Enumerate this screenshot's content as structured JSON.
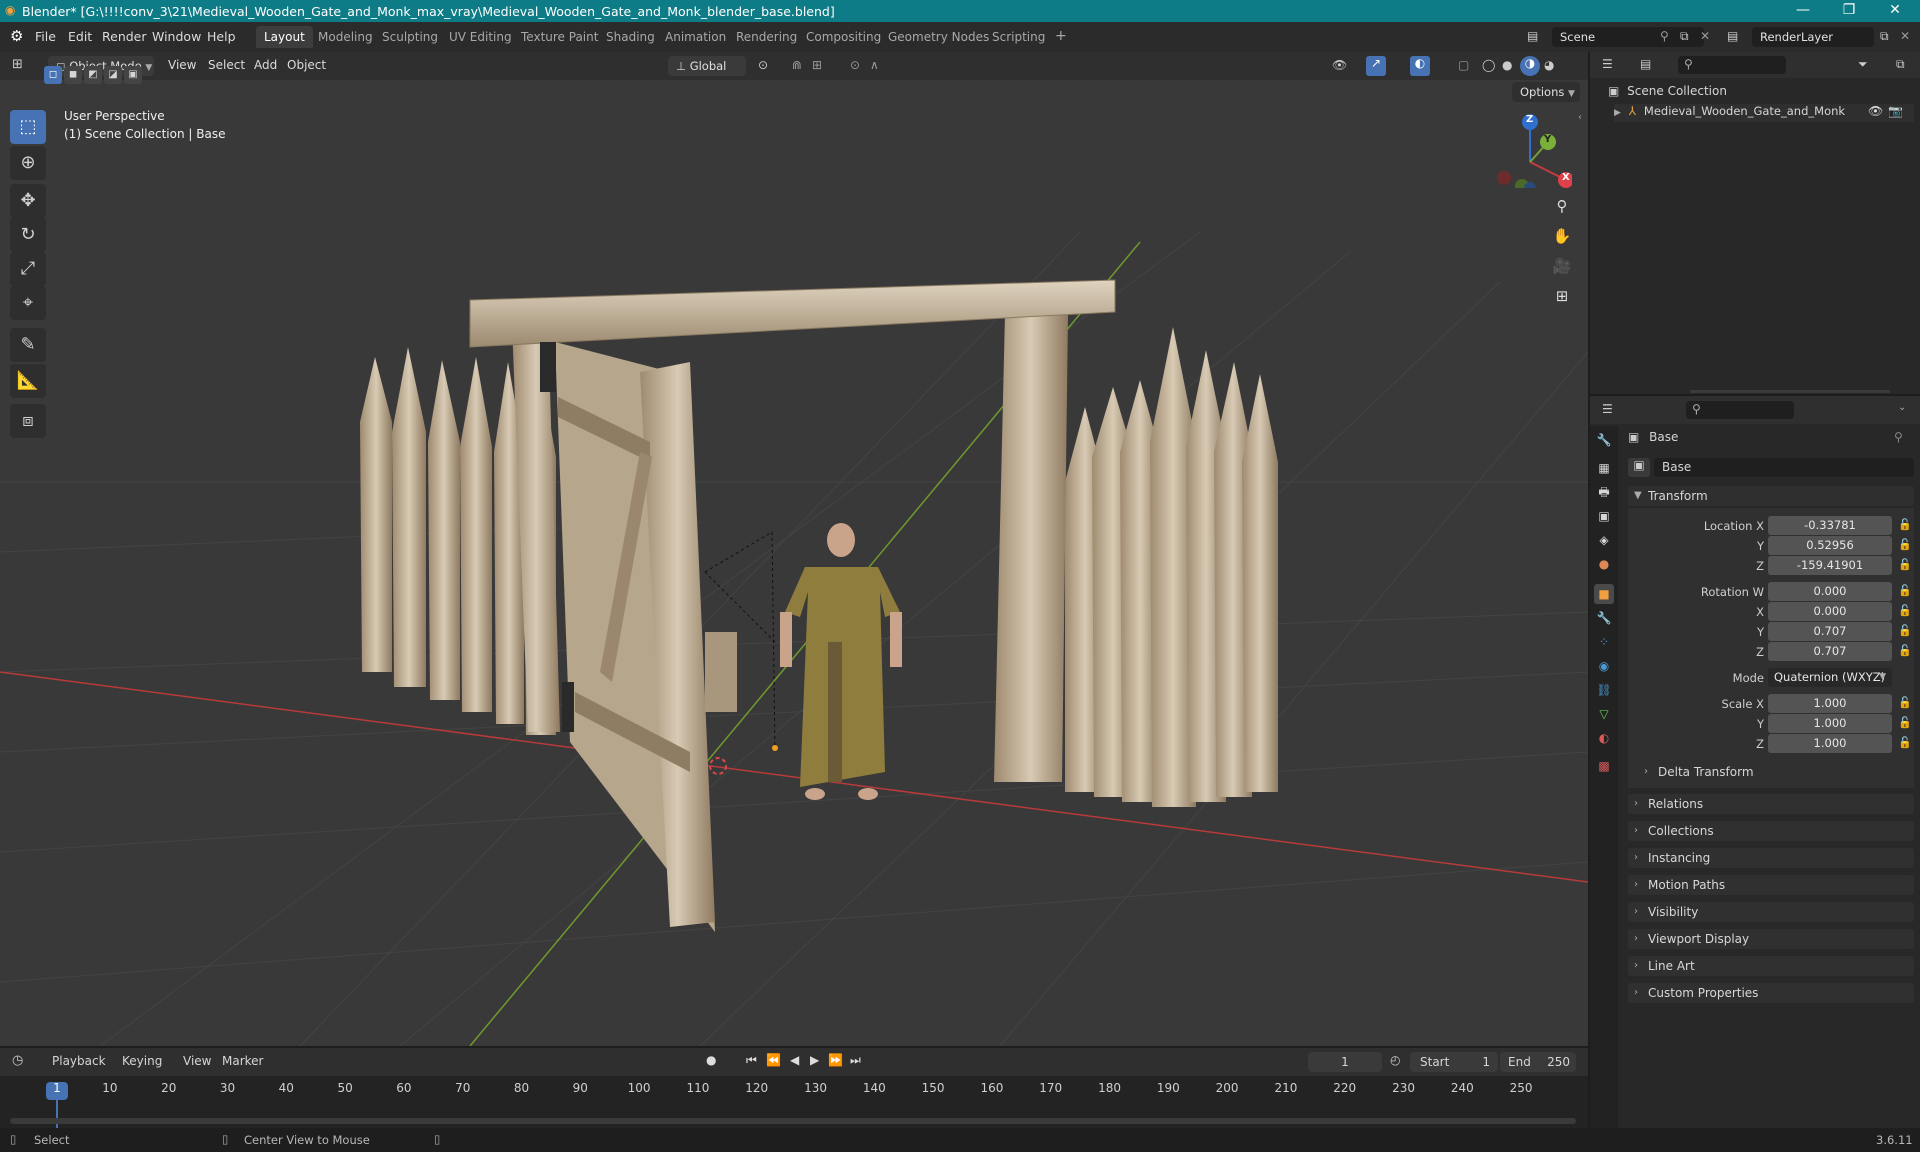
{
  "titlebar": {
    "title": "Blender* [G:\\!!!!conv_3\\21\\Medieval_Wooden_Gate_and_Monk_max_vray\\Medieval_Wooden_Gate_and_Monk_blender_base.blend]",
    "minimize": "—",
    "maximize": "❐",
    "close": "✕"
  },
  "menubar": {
    "file": "File",
    "edit": "Edit",
    "render": "Render",
    "window": "Window",
    "help": "Help",
    "workspaces": [
      "Layout",
      "Modeling",
      "Sculpting",
      "UV Editing",
      "Texture Paint",
      "Shading",
      "Animation",
      "Rendering",
      "Compositing",
      "Geometry Nodes",
      "Scripting"
    ],
    "add_workspace": "+",
    "scene": "Scene",
    "view_layer": "RenderLayer"
  },
  "viewport": {
    "mode": "Object Mode",
    "menus": [
      "View",
      "Select",
      "Add",
      "Object"
    ],
    "transform_orientation": "Global",
    "options": "Options",
    "overlay_title": "User Perspective",
    "overlay_subtitle": "(1) Scene Collection | Base",
    "gizmo": {
      "x": "X",
      "y": "Y",
      "z": "Z"
    }
  },
  "outliner": {
    "root": "Scene Collection",
    "item": "Medieval_Wooden_Gate_and_Monk"
  },
  "properties": {
    "object_name": "Base",
    "data_name": "Base",
    "transform_header": "Transform",
    "location_label": "Location X",
    "y_label": "Y",
    "z_label": "Z",
    "x_label": "X",
    "location": {
      "x": "-0.33781",
      "y": "0.52956",
      "z": "-159.41901"
    },
    "rotation_label": "Rotation W",
    "rotation": {
      "w": "0.000",
      "x": "0.000",
      "y": "0.707",
      "z": "0.707"
    },
    "mode_label": "Mode",
    "mode_value": "Quaternion (WXYZ)",
    "scale_label": "Scale X",
    "scale": {
      "x": "1.000",
      "y": "1.000",
      "z": "1.000"
    },
    "delta_transform": "Delta Transform",
    "panels": [
      "Relations",
      "Collections",
      "Instancing",
      "Motion Paths",
      "Visibility",
      "Viewport Display",
      "Line Art",
      "Custom Properties"
    ]
  },
  "timeline": {
    "menus": [
      "Playback",
      "Keying",
      "View",
      "Marker"
    ],
    "current_frame": "1",
    "start_label": "Start",
    "start": "1",
    "end_label": "End",
    "end": "250",
    "ticks": [
      "1",
      "10",
      "20",
      "30",
      "40",
      "50",
      "60",
      "70",
      "80",
      "90",
      "100",
      "110",
      "120",
      "130",
      "140",
      "150",
      "160",
      "170",
      "180",
      "190",
      "200",
      "210",
      "220",
      "230",
      "240",
      "250"
    ]
  },
  "statusbar": {
    "select": "Select",
    "center_view": "Center View to Mouse",
    "version": "3.6.11"
  },
  "colors": {
    "titlebar": "#0e7c86",
    "accent": "#4772b3",
    "viewport_bg": "#393939",
    "x_axis": "#b83a3a",
    "y_axis": "#6f9a2e"
  }
}
